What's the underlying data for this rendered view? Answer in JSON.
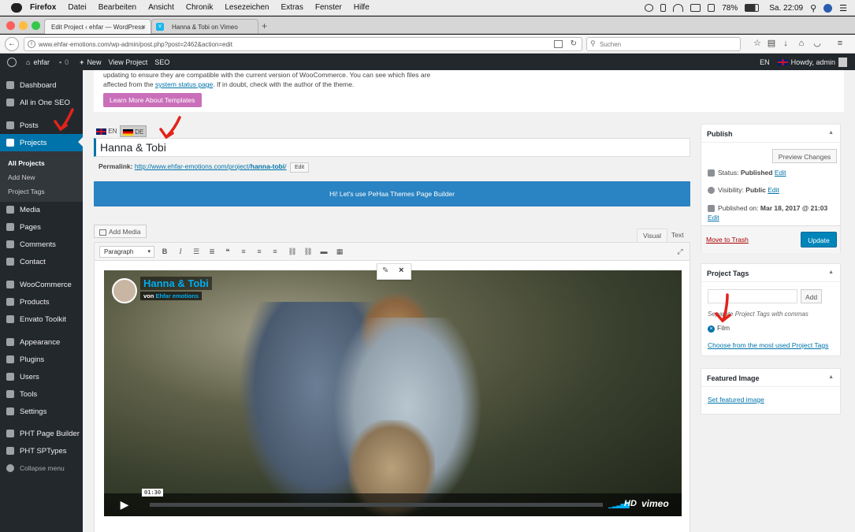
{
  "mac_menu": {
    "app": "Firefox",
    "items": [
      "Datei",
      "Bearbeiten",
      "Ansicht",
      "Chronik",
      "Lesezeichen",
      "Extras",
      "Fenster",
      "Hilfe"
    ],
    "battery": "78%",
    "clock": "Sa. 22:09"
  },
  "browser": {
    "tabs": [
      {
        "label": "Edit Project ‹ ehfar — WordPress"
      },
      {
        "label": "Hanna & Tobi on Vimeo"
      }
    ],
    "url": "www.ehfar-emotions.com/wp-admin/post.php?post=2462&action=edit",
    "search_placeholder": "Suchen"
  },
  "admin_bar": {
    "site": "ehfar",
    "comments": "0",
    "new": "New",
    "view": "View Project",
    "seo": "SEO",
    "lang": "EN",
    "howdy": "Howdy, admin"
  },
  "sidebar": {
    "items": [
      {
        "label": "Dashboard"
      },
      {
        "label": "All in One SEO"
      },
      {
        "label": "Posts"
      },
      {
        "label": "Projects"
      },
      {
        "label": "Media"
      },
      {
        "label": "Pages"
      },
      {
        "label": "Comments"
      },
      {
        "label": "Contact"
      },
      {
        "label": "WooCommerce"
      },
      {
        "label": "Products"
      },
      {
        "label": "Envato Toolkit"
      },
      {
        "label": "Appearance"
      },
      {
        "label": "Plugins"
      },
      {
        "label": "Users"
      },
      {
        "label": "Tools"
      },
      {
        "label": "Settings"
      },
      {
        "label": "PHT Page Builder"
      },
      {
        "label": "PHT SPTypes"
      },
      {
        "label": "Collapse menu"
      }
    ],
    "sub": [
      "All Projects",
      "Add New",
      "Project Tags"
    ]
  },
  "notice": {
    "line1": "updating to ensure they are compatible with the current version of WooCommerce. You can see which files are",
    "line2a": "affected from the",
    "link": "system status page",
    "line2b": ". If in doubt, check with the author of the theme.",
    "button": "Learn More About Templates"
  },
  "editor": {
    "lang_en": "EN",
    "lang_de": "DE",
    "title": "Hanna & Tobi",
    "permalink_label": "Permalink:",
    "permalink_url": "http://www.ehfar-emotions.com/project/",
    "permalink_slug": "hanna-tobi",
    "permalink_end": "/",
    "edit": "Edit",
    "builder": "Hi! Let's use PeHaa Themes Page Builder",
    "add_media": "Add Media",
    "tab_visual": "Visual",
    "tab_text": "Text",
    "format": "Paragraph"
  },
  "video": {
    "title": "Hanna & Tobi",
    "by": "von",
    "author": "Ehfar emotions",
    "time": "01:30",
    "hd": "HD",
    "brand": "vimeo"
  },
  "publish": {
    "heading": "Publish",
    "preview": "Preview Changes",
    "status_label": "Status:",
    "status": "Published",
    "visibility_label": "Visibility:",
    "visibility": "Public",
    "published_label": "Published on:",
    "published": "Mar 18, 2017 @ 21:03",
    "edit": "Edit",
    "trash": "Move to Trash",
    "update": "Update"
  },
  "tags": {
    "heading": "Project Tags",
    "add": "Add",
    "hint": "Separate Project Tags with commas",
    "tag": "Film",
    "choose": "Choose from the most used Project Tags"
  },
  "featured": {
    "heading": "Featured Image",
    "link": "Set featured image"
  },
  "colors": {
    "wp_blue": "#0073aa",
    "admin_dark": "#23282d",
    "builder_blue": "#2a83c2",
    "notice_button": "#c96fba",
    "annotation_red": "#e2231a"
  }
}
